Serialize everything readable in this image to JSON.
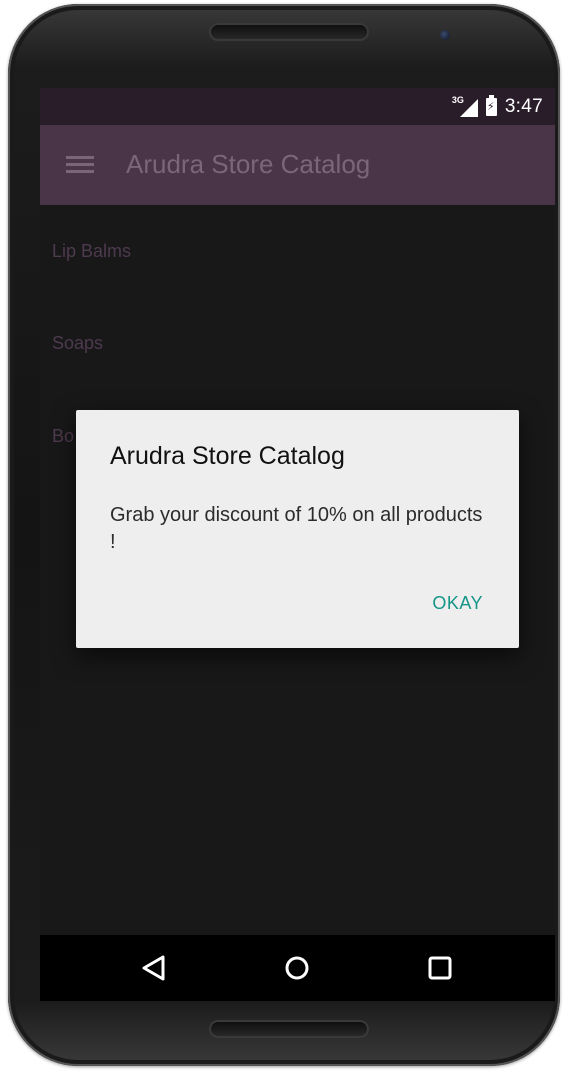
{
  "status_bar": {
    "network": "3G",
    "time": "3:47"
  },
  "app_bar": {
    "title": "Arudra Store Catalog",
    "menu_icon": "hamburger-menu-icon"
  },
  "categories": [
    {
      "label": "Lip Balms"
    },
    {
      "label": "Soaps"
    },
    {
      "label": "Bo"
    }
  ],
  "dialog": {
    "title": "Arudra Store Catalog",
    "message": "Grab your discount of 10% on all products !",
    "button_label": "OKAY"
  },
  "nav_bar": {
    "back_icon": "back-triangle-icon",
    "home_icon": "home-circle-icon",
    "recents_icon": "recents-square-icon"
  },
  "colors": {
    "status_bar": "#2a1d2a",
    "app_bar": "#4a3448",
    "accent": "#159688",
    "dialog_bg": "#eeeeee"
  }
}
